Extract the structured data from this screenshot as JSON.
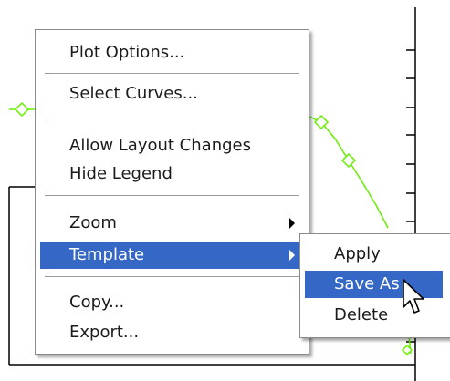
{
  "context_menu": {
    "items": [
      {
        "label": "Plot Options..."
      },
      {
        "label": "Select Curves..."
      },
      {
        "label": "Allow Layout Changes"
      },
      {
        "label": "Hide Legend"
      },
      {
        "label": "Zoom"
      },
      {
        "label": "Template"
      },
      {
        "label": "Copy..."
      },
      {
        "label": "Export..."
      }
    ],
    "highlighted_item": "Template"
  },
  "template_submenu": {
    "items": [
      {
        "label": "Apply"
      },
      {
        "label": "Save As"
      },
      {
        "label": "Delete"
      }
    ],
    "highlighted_item": "Save As"
  },
  "colors": {
    "highlight": "#3567c6",
    "curve": "#66ee00",
    "menu_background": "#ffffff"
  },
  "icons": {
    "submenu_arrow": "chevron-right-icon",
    "cursor": "mouse-pointer-icon",
    "curve_marker": "diamond-marker-icon"
  }
}
